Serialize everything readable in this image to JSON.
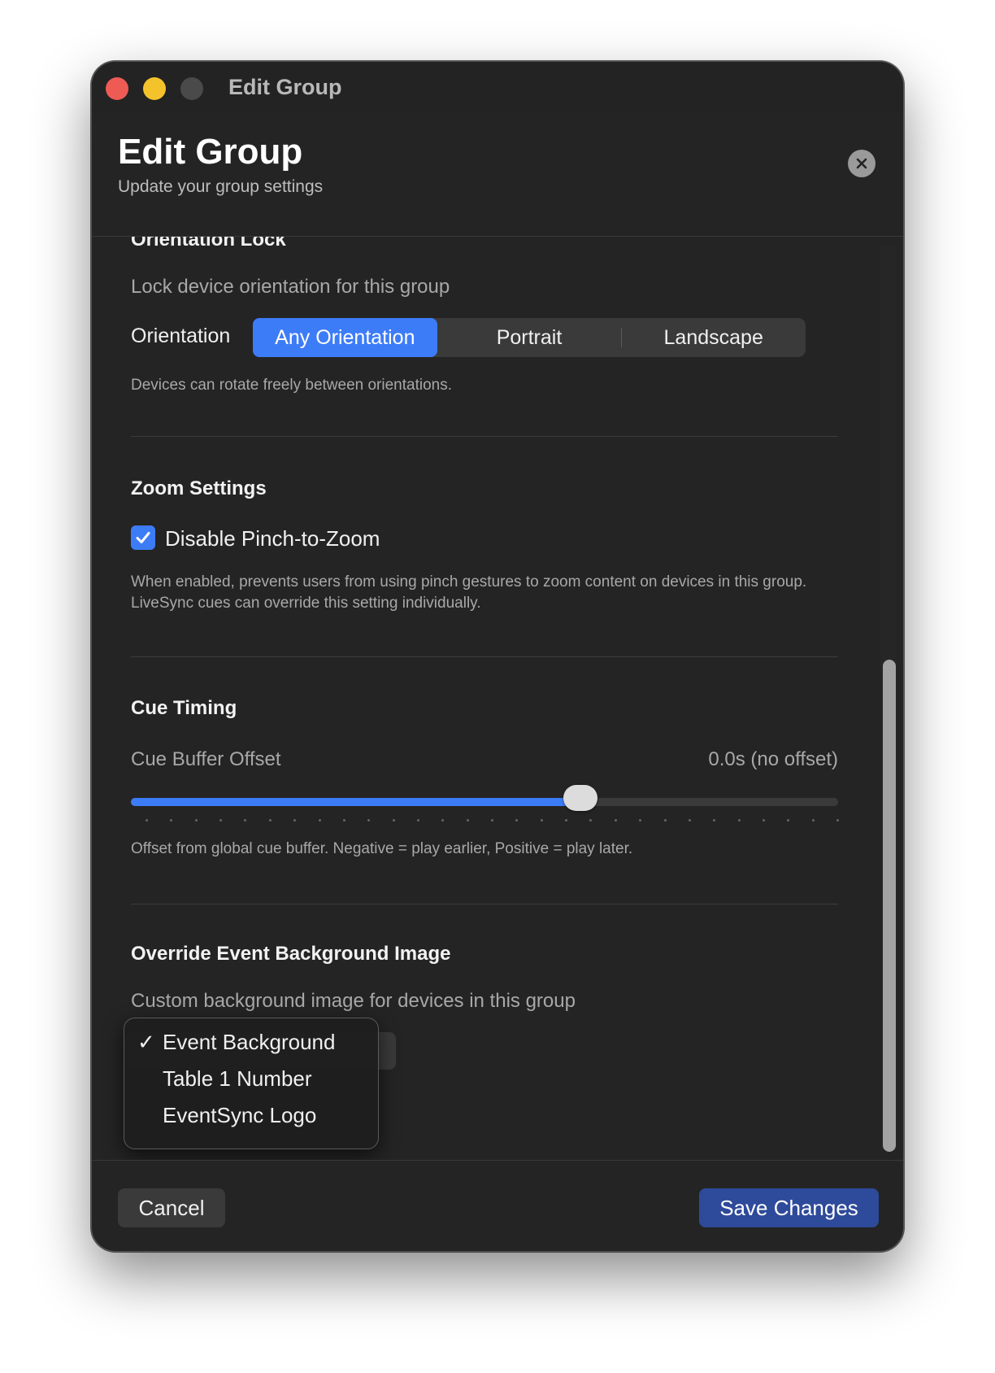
{
  "window": {
    "title": "Edit Group"
  },
  "header": {
    "title": "Edit Group",
    "subtitle": "Update your group settings"
  },
  "orientation": {
    "section_title": "Orientation Lock",
    "description": "Lock device orientation for this group",
    "label": "Orientation",
    "options": [
      "Any Orientation",
      "Portrait",
      "Landscape"
    ],
    "selected": "Any Orientation",
    "help": "Devices can rotate freely between orientations."
  },
  "zoom": {
    "section_title": "Zoom Settings",
    "checkbox_label": "Disable Pinch-to-Zoom",
    "checked": true,
    "help": "When enabled, prevents users from using pinch gestures to zoom content on devices in this group. LiveSync cues can override this setting individually."
  },
  "cue": {
    "section_title": "Cue Timing",
    "slider_label": "Cue Buffer Offset",
    "value_text": "0.0s (no offset)",
    "slider_fraction": 0.636,
    "help": "Offset from global cue buffer. Negative = play earlier, Positive = play later."
  },
  "background": {
    "section_title": "Override Event Background Image",
    "description": "Custom background image for devices in this group",
    "menu_items": [
      {
        "label": "Event Background",
        "checked": true
      },
      {
        "label": "Table 1 Number",
        "checked": false
      },
      {
        "label": "EventSync Logo",
        "checked": false
      }
    ],
    "checkmark": "✓"
  },
  "footer": {
    "cancel_label": "Cancel",
    "save_label": "Save Changes"
  },
  "colors": {
    "accent": "#3d7cf7",
    "save": "#2e4a9a",
    "background": "#242424"
  }
}
